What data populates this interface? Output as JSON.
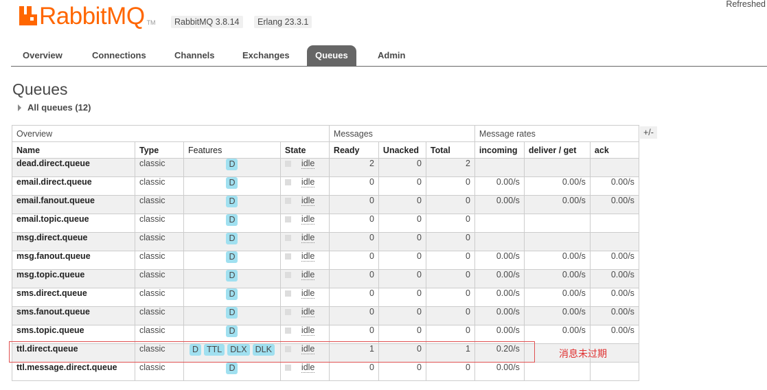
{
  "header": {
    "logo_text": "RabbitMQ",
    "logo_tm": "TM",
    "version": "RabbitMQ 3.8.14",
    "erlang": "Erlang 23.3.1",
    "refreshed": "Refreshed"
  },
  "tabs": [
    {
      "label": "Overview",
      "active": false
    },
    {
      "label": "Connections",
      "active": false
    },
    {
      "label": "Channels",
      "active": false
    },
    {
      "label": "Exchanges",
      "active": false
    },
    {
      "label": "Queues",
      "active": true
    },
    {
      "label": "Admin",
      "active": false
    }
  ],
  "page": {
    "title": "Queues",
    "all_queues": "All queues (12)",
    "columns_toggle": "+/-"
  },
  "table": {
    "groups": {
      "overview": "Overview",
      "messages": "Messages",
      "rates": "Message rates"
    },
    "headers": {
      "name": "Name",
      "type": "Type",
      "features": "Features",
      "state": "State",
      "ready": "Ready",
      "unacked": "Unacked",
      "total": "Total",
      "incoming": "incoming",
      "deliver": "deliver / get",
      "ack": "ack"
    },
    "rows": [
      {
        "name": "dead.direct.queue",
        "type": "classic",
        "features": [
          "D"
        ],
        "state": "idle",
        "ready": "2",
        "unacked": "0",
        "total": "2",
        "incoming": "",
        "deliver": "",
        "ack": ""
      },
      {
        "name": "email.direct.queue",
        "type": "classic",
        "features": [
          "D"
        ],
        "state": "idle",
        "ready": "0",
        "unacked": "0",
        "total": "0",
        "incoming": "0.00/s",
        "deliver": "0.00/s",
        "ack": "0.00/s"
      },
      {
        "name": "email.fanout.queue",
        "type": "classic",
        "features": [
          "D"
        ],
        "state": "idle",
        "ready": "0",
        "unacked": "0",
        "total": "0",
        "incoming": "0.00/s",
        "deliver": "0.00/s",
        "ack": "0.00/s"
      },
      {
        "name": "email.topic.queue",
        "type": "classic",
        "features": [
          "D"
        ],
        "state": "idle",
        "ready": "0",
        "unacked": "0",
        "total": "0",
        "incoming": "",
        "deliver": "",
        "ack": ""
      },
      {
        "name": "msg.direct.queue",
        "type": "classic",
        "features": [
          "D"
        ],
        "state": "idle",
        "ready": "0",
        "unacked": "0",
        "total": "0",
        "incoming": "",
        "deliver": "",
        "ack": ""
      },
      {
        "name": "msg.fanout.queue",
        "type": "classic",
        "features": [
          "D"
        ],
        "state": "idle",
        "ready": "0",
        "unacked": "0",
        "total": "0",
        "incoming": "0.00/s",
        "deliver": "0.00/s",
        "ack": "0.00/s"
      },
      {
        "name": "msg.topic.queue",
        "type": "classic",
        "features": [
          "D"
        ],
        "state": "idle",
        "ready": "0",
        "unacked": "0",
        "total": "0",
        "incoming": "0.00/s",
        "deliver": "0.00/s",
        "ack": "0.00/s"
      },
      {
        "name": "sms.direct.queue",
        "type": "classic",
        "features": [
          "D"
        ],
        "state": "idle",
        "ready": "0",
        "unacked": "0",
        "total": "0",
        "incoming": "0.00/s",
        "deliver": "0.00/s",
        "ack": "0.00/s"
      },
      {
        "name": "sms.fanout.queue",
        "type": "classic",
        "features": [
          "D"
        ],
        "state": "idle",
        "ready": "0",
        "unacked": "0",
        "total": "0",
        "incoming": "0.00/s",
        "deliver": "0.00/s",
        "ack": "0.00/s"
      },
      {
        "name": "sms.topic.queue",
        "type": "classic",
        "features": [
          "D"
        ],
        "state": "idle",
        "ready": "0",
        "unacked": "0",
        "total": "0",
        "incoming": "0.00/s",
        "deliver": "0.00/s",
        "ack": "0.00/s"
      },
      {
        "name": "ttl.direct.queue",
        "type": "classic",
        "features": [
          "D",
          "TTL",
          "DLX",
          "DLK"
        ],
        "state": "idle",
        "ready": "1",
        "unacked": "0",
        "total": "1",
        "incoming": "0.20/s",
        "deliver": "",
        "ack": ""
      },
      {
        "name": "ttl.message.direct.queue",
        "type": "classic",
        "features": [
          "D"
        ],
        "state": "idle",
        "ready": "0",
        "unacked": "0",
        "total": "0",
        "incoming": "0.00/s",
        "deliver": "",
        "ack": ""
      }
    ]
  },
  "annotation": {
    "text": "消息未过期",
    "color": "#e03030"
  },
  "colors": {
    "brand": "#ff6600",
    "active_tab": "#666666",
    "feature_badge": "#a0e0f0"
  }
}
